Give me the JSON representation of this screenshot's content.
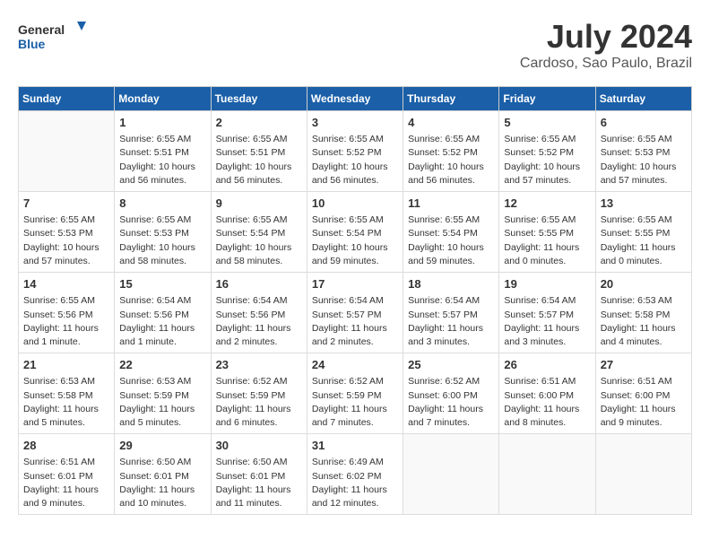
{
  "header": {
    "logo_line1": "General",
    "logo_line2": "Blue",
    "month_year": "July 2024",
    "location": "Cardoso, Sao Paulo, Brazil"
  },
  "weekdays": [
    "Sunday",
    "Monday",
    "Tuesday",
    "Wednesday",
    "Thursday",
    "Friday",
    "Saturday"
  ],
  "weeks": [
    [
      {
        "day": "",
        "info": ""
      },
      {
        "day": "1",
        "info": "Sunrise: 6:55 AM\nSunset: 5:51 PM\nDaylight: 10 hours\nand 56 minutes."
      },
      {
        "day": "2",
        "info": "Sunrise: 6:55 AM\nSunset: 5:51 PM\nDaylight: 10 hours\nand 56 minutes."
      },
      {
        "day": "3",
        "info": "Sunrise: 6:55 AM\nSunset: 5:52 PM\nDaylight: 10 hours\nand 56 minutes."
      },
      {
        "day": "4",
        "info": "Sunrise: 6:55 AM\nSunset: 5:52 PM\nDaylight: 10 hours\nand 56 minutes."
      },
      {
        "day": "5",
        "info": "Sunrise: 6:55 AM\nSunset: 5:52 PM\nDaylight: 10 hours\nand 57 minutes."
      },
      {
        "day": "6",
        "info": "Sunrise: 6:55 AM\nSunset: 5:53 PM\nDaylight: 10 hours\nand 57 minutes."
      }
    ],
    [
      {
        "day": "7",
        "info": "Sunrise: 6:55 AM\nSunset: 5:53 PM\nDaylight: 10 hours\nand 57 minutes."
      },
      {
        "day": "8",
        "info": "Sunrise: 6:55 AM\nSunset: 5:53 PM\nDaylight: 10 hours\nand 58 minutes."
      },
      {
        "day": "9",
        "info": "Sunrise: 6:55 AM\nSunset: 5:54 PM\nDaylight: 10 hours\nand 58 minutes."
      },
      {
        "day": "10",
        "info": "Sunrise: 6:55 AM\nSunset: 5:54 PM\nDaylight: 10 hours\nand 59 minutes."
      },
      {
        "day": "11",
        "info": "Sunrise: 6:55 AM\nSunset: 5:54 PM\nDaylight: 10 hours\nand 59 minutes."
      },
      {
        "day": "12",
        "info": "Sunrise: 6:55 AM\nSunset: 5:55 PM\nDaylight: 11 hours\nand 0 minutes."
      },
      {
        "day": "13",
        "info": "Sunrise: 6:55 AM\nSunset: 5:55 PM\nDaylight: 11 hours\nand 0 minutes."
      }
    ],
    [
      {
        "day": "14",
        "info": "Sunrise: 6:55 AM\nSunset: 5:56 PM\nDaylight: 11 hours\nand 1 minute."
      },
      {
        "day": "15",
        "info": "Sunrise: 6:54 AM\nSunset: 5:56 PM\nDaylight: 11 hours\nand 1 minute."
      },
      {
        "day": "16",
        "info": "Sunrise: 6:54 AM\nSunset: 5:56 PM\nDaylight: 11 hours\nand 2 minutes."
      },
      {
        "day": "17",
        "info": "Sunrise: 6:54 AM\nSunset: 5:57 PM\nDaylight: 11 hours\nand 2 minutes."
      },
      {
        "day": "18",
        "info": "Sunrise: 6:54 AM\nSunset: 5:57 PM\nDaylight: 11 hours\nand 3 minutes."
      },
      {
        "day": "19",
        "info": "Sunrise: 6:54 AM\nSunset: 5:57 PM\nDaylight: 11 hours\nand 3 minutes."
      },
      {
        "day": "20",
        "info": "Sunrise: 6:53 AM\nSunset: 5:58 PM\nDaylight: 11 hours\nand 4 minutes."
      }
    ],
    [
      {
        "day": "21",
        "info": "Sunrise: 6:53 AM\nSunset: 5:58 PM\nDaylight: 11 hours\nand 5 minutes."
      },
      {
        "day": "22",
        "info": "Sunrise: 6:53 AM\nSunset: 5:59 PM\nDaylight: 11 hours\nand 5 minutes."
      },
      {
        "day": "23",
        "info": "Sunrise: 6:52 AM\nSunset: 5:59 PM\nDaylight: 11 hours\nand 6 minutes."
      },
      {
        "day": "24",
        "info": "Sunrise: 6:52 AM\nSunset: 5:59 PM\nDaylight: 11 hours\nand 7 minutes."
      },
      {
        "day": "25",
        "info": "Sunrise: 6:52 AM\nSunset: 6:00 PM\nDaylight: 11 hours\nand 7 minutes."
      },
      {
        "day": "26",
        "info": "Sunrise: 6:51 AM\nSunset: 6:00 PM\nDaylight: 11 hours\nand 8 minutes."
      },
      {
        "day": "27",
        "info": "Sunrise: 6:51 AM\nSunset: 6:00 PM\nDaylight: 11 hours\nand 9 minutes."
      }
    ],
    [
      {
        "day": "28",
        "info": "Sunrise: 6:51 AM\nSunset: 6:01 PM\nDaylight: 11 hours\nand 9 minutes."
      },
      {
        "day": "29",
        "info": "Sunrise: 6:50 AM\nSunset: 6:01 PM\nDaylight: 11 hours\nand 10 minutes."
      },
      {
        "day": "30",
        "info": "Sunrise: 6:50 AM\nSunset: 6:01 PM\nDaylight: 11 hours\nand 11 minutes."
      },
      {
        "day": "31",
        "info": "Sunrise: 6:49 AM\nSunset: 6:02 PM\nDaylight: 11 hours\nand 12 minutes."
      },
      {
        "day": "",
        "info": ""
      },
      {
        "day": "",
        "info": ""
      },
      {
        "day": "",
        "info": ""
      }
    ]
  ]
}
